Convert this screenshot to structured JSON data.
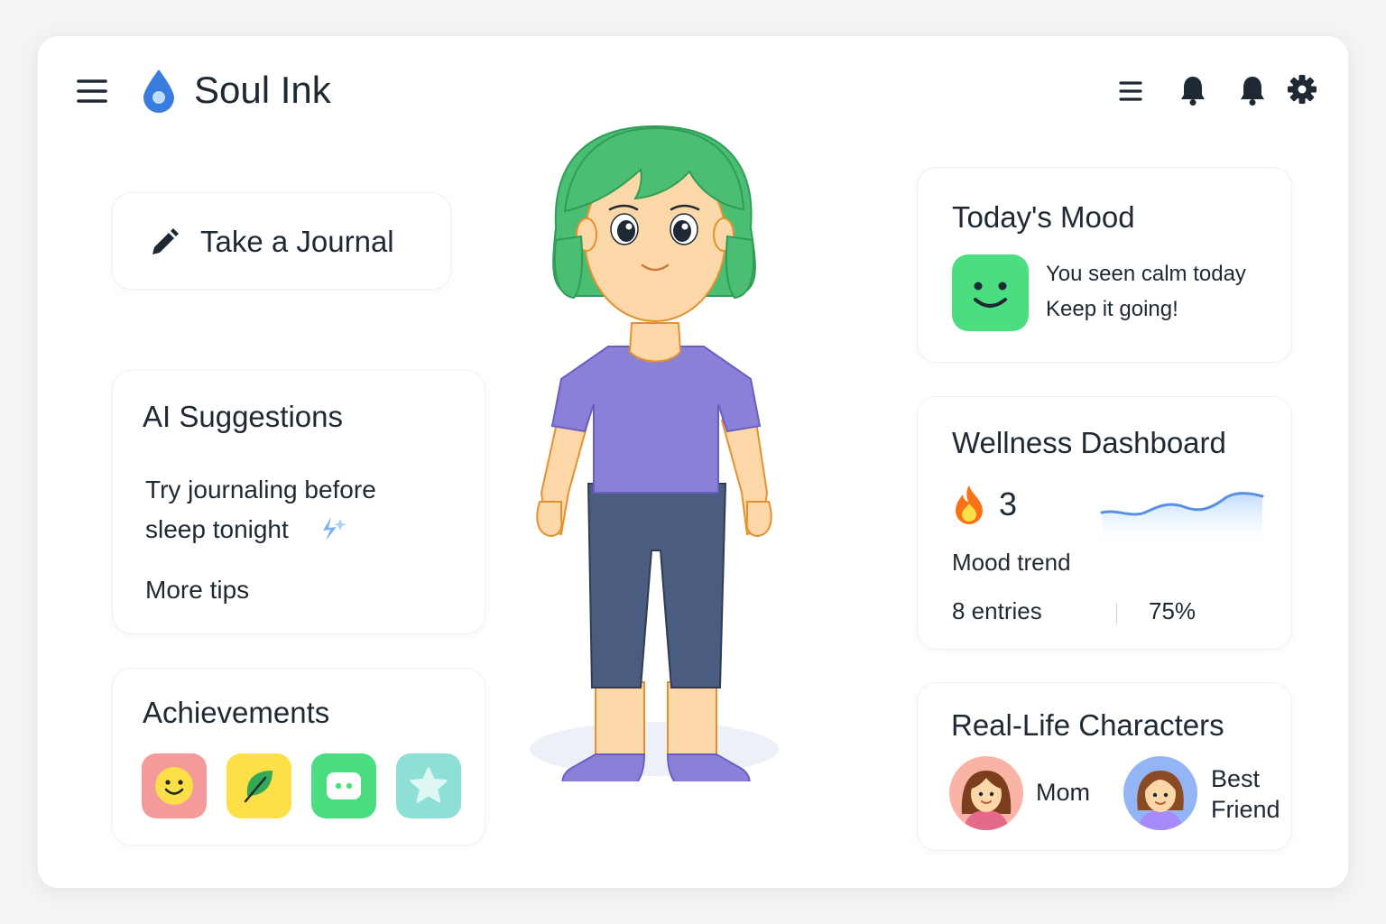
{
  "app": {
    "title": "Soul Ink"
  },
  "header": {
    "icons": [
      "menu-icon",
      "list-icon",
      "bell-icon",
      "bell-icon",
      "gear-icon"
    ]
  },
  "journal": {
    "label": "Take a Journal",
    "icon": "pencil-icon"
  },
  "suggestions": {
    "title": "AI Suggestions",
    "text_line1": "Try journaling before",
    "text_line2": "sleep tonight",
    "icon": "sparkle-icon",
    "more_link": "More tips"
  },
  "achievements": {
    "title": "Achievements",
    "badges": [
      {
        "icon": "smiley-badge-icon",
        "color": "#f59a9a"
      },
      {
        "icon": "leaf-badge-icon",
        "color": "#fde047"
      },
      {
        "icon": "chat-badge-icon",
        "color": "#4ade80"
      },
      {
        "icon": "star-badge-icon",
        "color": "#8ee0d6"
      }
    ]
  },
  "mood": {
    "title": "Today's Mood",
    "icon": "smiley-mood-icon",
    "color": "#4ade80",
    "line1": "You seen calm today",
    "line2": "Keep it going!"
  },
  "wellness": {
    "title": "Wellness Dashboard",
    "streak_icon": "fire-icon",
    "streak": "3",
    "trend_label": "Mood trend",
    "entries": "8 entries",
    "percent": "75%"
  },
  "characters": {
    "title": "Real-Life Characters",
    "people": [
      {
        "name": "Mom",
        "icon": "mom-avatar-icon",
        "bg": "#f9b4a6"
      },
      {
        "name_line1": "Best",
        "name_line2": "Friend",
        "icon": "friend-avatar-icon",
        "bg": "#93b4f5"
      }
    ]
  },
  "avatar": {
    "icon": "girl-avatar-figure"
  },
  "colors": {
    "accent": "#3b82f6",
    "hair": "#4cbe74",
    "shirt": "#8b80d8",
    "pants": "#4a5d80",
    "skin": "#fcd7a8"
  }
}
